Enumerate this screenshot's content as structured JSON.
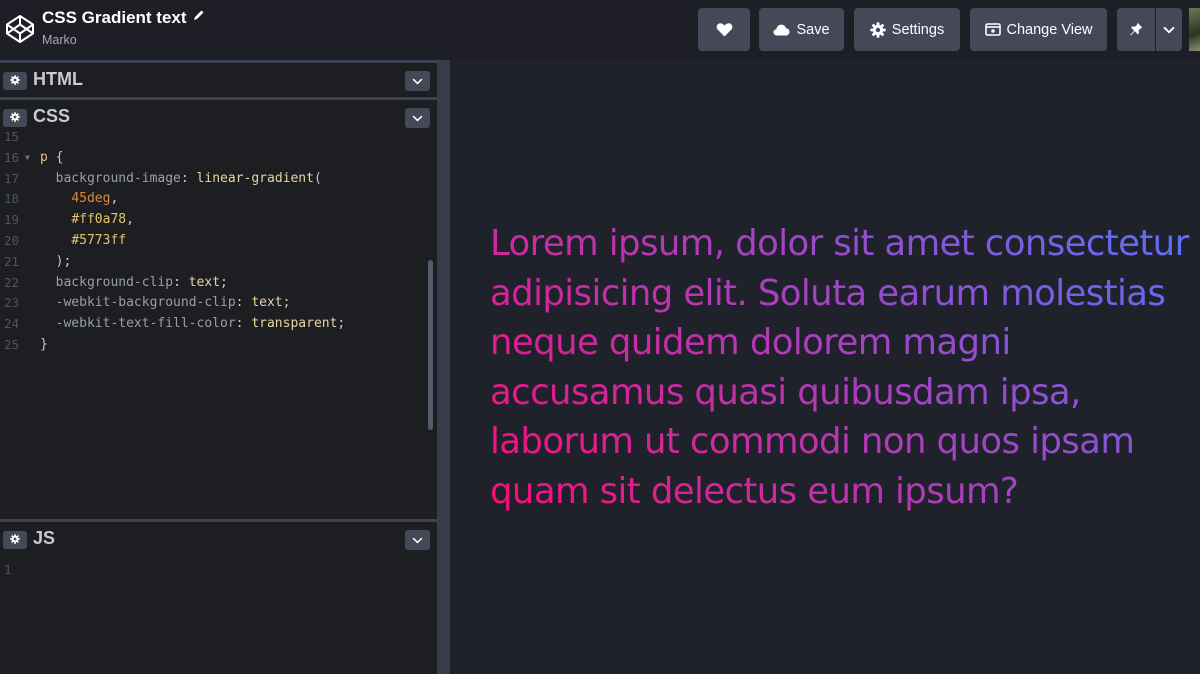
{
  "header": {
    "title": "CSS Gradient text",
    "author": "Marko",
    "buttons": {
      "save": "Save",
      "settings": "Settings",
      "change_view": "Change View"
    }
  },
  "panels": {
    "html": {
      "name": "HTML"
    },
    "css": {
      "name": "CSS"
    },
    "js": {
      "name": "JS"
    }
  },
  "css_code": [
    {
      "n": "15",
      "parts": []
    },
    {
      "n": "16",
      "fold": true,
      "parts": [
        [
          "p",
          "c-sel"
        ],
        [
          " {",
          "c-pun"
        ]
      ]
    },
    {
      "n": "17",
      "parts": [
        [
          "  background-image",
          "c-prop"
        ],
        [
          ": ",
          "c-pun"
        ],
        [
          "linear-gradient",
          "c-fn"
        ],
        [
          "(",
          "c-pun"
        ]
      ]
    },
    {
      "n": "18",
      "parts": [
        [
          "    ",
          "c-pun"
        ],
        [
          "45deg",
          "c-num"
        ],
        [
          ",",
          "c-pun"
        ]
      ]
    },
    {
      "n": "19",
      "parts": [
        [
          "    ",
          "c-pun"
        ],
        [
          "#ff0a78",
          "c-hex"
        ],
        [
          ",",
          "c-pun"
        ]
      ]
    },
    {
      "n": "20",
      "parts": [
        [
          "    ",
          "c-pun"
        ],
        [
          "#5773ff",
          "c-hex"
        ]
      ]
    },
    {
      "n": "21",
      "parts": [
        [
          "  );",
          "c-pun"
        ]
      ]
    },
    {
      "n": "22",
      "parts": [
        [
          "  background-clip",
          "c-prop"
        ],
        [
          ": ",
          "c-pun"
        ],
        [
          "text",
          "c-val"
        ],
        [
          ";",
          "c-pun"
        ]
      ]
    },
    {
      "n": "23",
      "parts": [
        [
          "  -webkit-background-clip",
          "c-prop"
        ],
        [
          ": ",
          "c-pun"
        ],
        [
          "text",
          "c-val"
        ],
        [
          ";",
          "c-pun"
        ]
      ]
    },
    {
      "n": "24",
      "parts": [
        [
          "  -webkit-text-fill-color",
          "c-prop"
        ],
        [
          ": ",
          "c-pun"
        ],
        [
          "transparent",
          "c-val"
        ],
        [
          ";",
          "c-pun"
        ]
      ]
    },
    {
      "n": "25",
      "parts": [
        [
          "}",
          "c-pun"
        ]
      ]
    }
  ],
  "js_code": [
    {
      "n": "1",
      "parts": []
    }
  ],
  "preview": {
    "paragraph": "Lorem ipsum, dolor sit amet consectetur adipisicing elit. Soluta earum molestias neque quidem dolorem magni accusamus quasi quibusdam ipsa, laborum ut commodi non quos ipsam quam sit delectus eum ipsum?"
  },
  "colors": {
    "gradient_start": "#ff0a78",
    "gradient_end": "#5773ff",
    "header_bg": "#1e1f26",
    "button_bg": "#444857",
    "preview_bg": "#1f222a"
  }
}
